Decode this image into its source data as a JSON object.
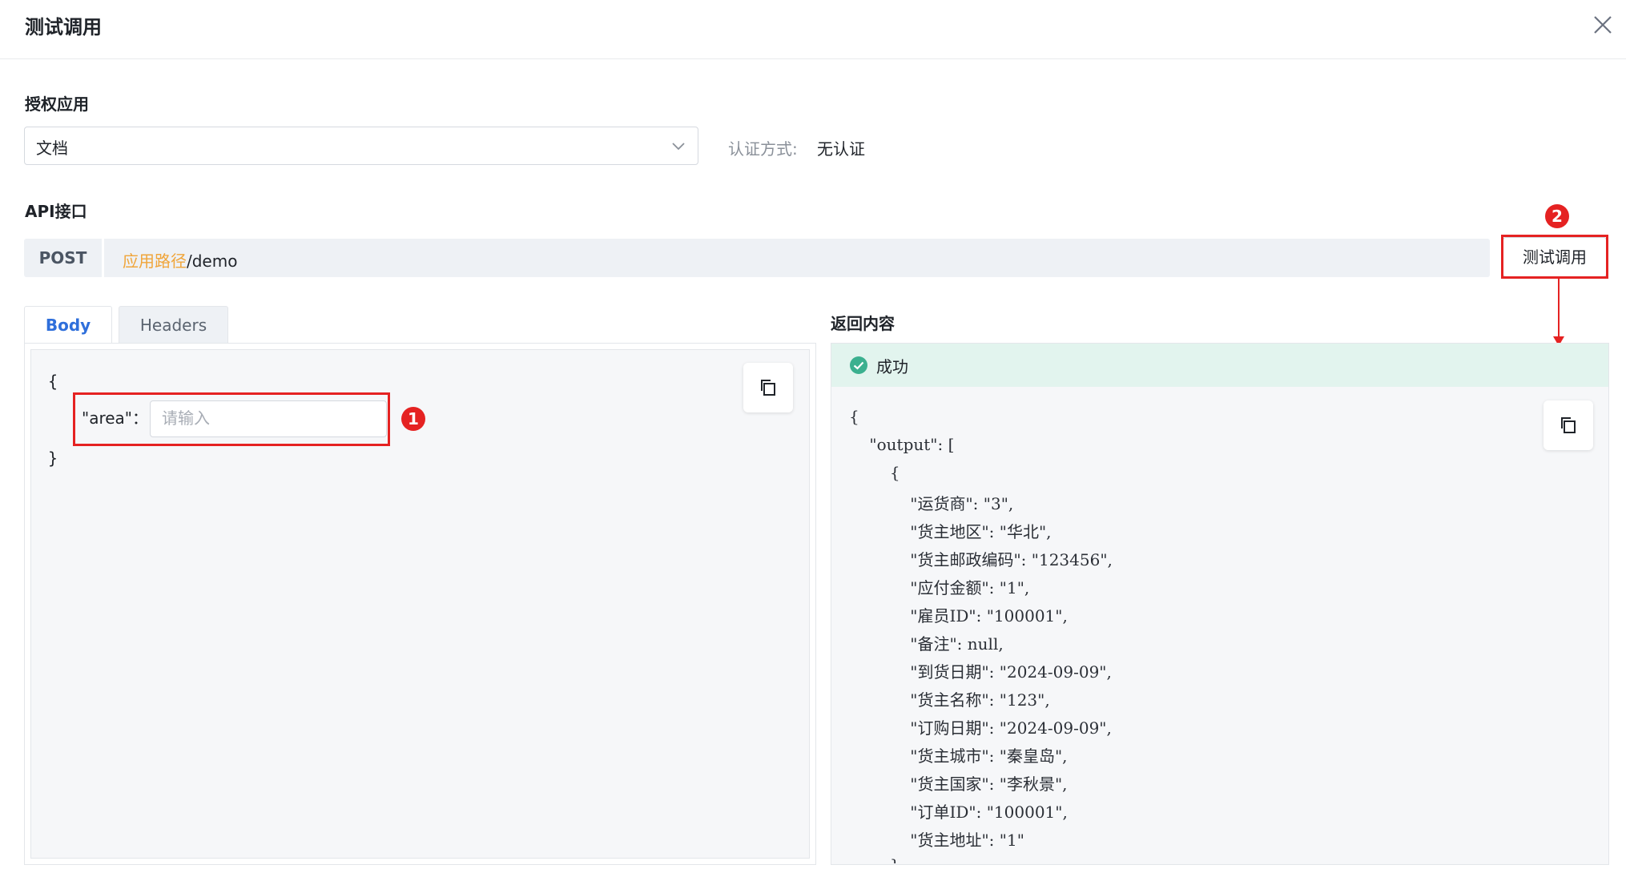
{
  "dialog": {
    "title": "测试调用"
  },
  "auth_app": {
    "label": "授权应用",
    "selected": "文档",
    "auth_method_label": "认证方式:",
    "auth_method_value": "无认证"
  },
  "api": {
    "label": "API接口",
    "method": "POST",
    "path_prefix": "应用路径",
    "path_suffix": "/demo",
    "test_button": "测试调用"
  },
  "tabs": [
    {
      "label": "Body"
    },
    {
      "label": "Headers"
    }
  ],
  "body_editor": {
    "open_brace": "{",
    "close_brace": "}",
    "key": "\"area\"：",
    "input_placeholder": "请输入",
    "input_value": ""
  },
  "response": {
    "label": "返回内容",
    "status": "成功",
    "status_color": "#3bb08f",
    "lines": [
      "{",
      "    \"output\": [",
      "        {",
      "            \"运货商\": \"3\",",
      "            \"货主地区\": \"华北\",",
      "            \"货主邮政编码\": \"123456\",",
      "            \"应付金额\": \"1\",",
      "            \"雇员ID\": \"100001\",",
      "            \"备注\": null,",
      "            \"到货日期\": \"2024-09-09\",",
      "            \"货主名称\": \"123\",",
      "            \"订购日期\": \"2024-09-09\",",
      "            \"货主城市\": \"秦皇岛\",",
      "            \"货主国家\": \"李秋景\",",
      "            \"订单ID\": \"100001\",",
      "            \"货主地址\": \"1\"",
      "        }"
    ]
  },
  "annotations": [
    {
      "number": "1"
    },
    {
      "number": "2"
    }
  ],
  "colors": {
    "accent_red": "#e52222",
    "path_orange": "#f0a53a",
    "tab_active": "#2f6fdb"
  }
}
